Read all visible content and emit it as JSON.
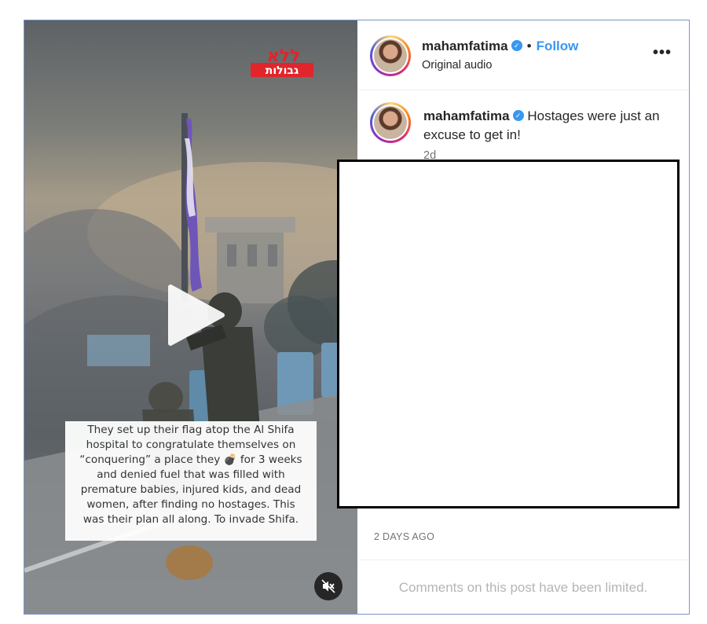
{
  "video": {
    "logo_text": "ללא גבולות",
    "caption": "They set up their flag atop the Al Shifa\nhospital to congratulate themselves on\n“conquering” a place they 💣 for 3 weeks\nand denied fuel that was filled with\npremature babies, injured kids, and dead\nwomen, after finding no hostages. This\nwas their plan all along. To invade Shifa.",
    "play_icon": "play-icon",
    "mute_icon": "speaker-muted-icon"
  },
  "header": {
    "username": "mahamfatima",
    "verified_glyph": "✓",
    "separator": "•",
    "follow_label": "Follow",
    "audio_label": "Original audio",
    "more_label": "•••"
  },
  "caption_comment": {
    "username": "mahamfatima",
    "verified_glyph": "✓",
    "text": "Hostages were just an excuse to get in!",
    "age": "2d"
  },
  "post": {
    "timestamp": "2 DAYS AGO",
    "comments_notice": "Comments on this post have been limited."
  },
  "colors": {
    "accent": "#3897f0",
    "text": "#262626",
    "muted": "#737373",
    "frame_border": "#7a93c8"
  }
}
